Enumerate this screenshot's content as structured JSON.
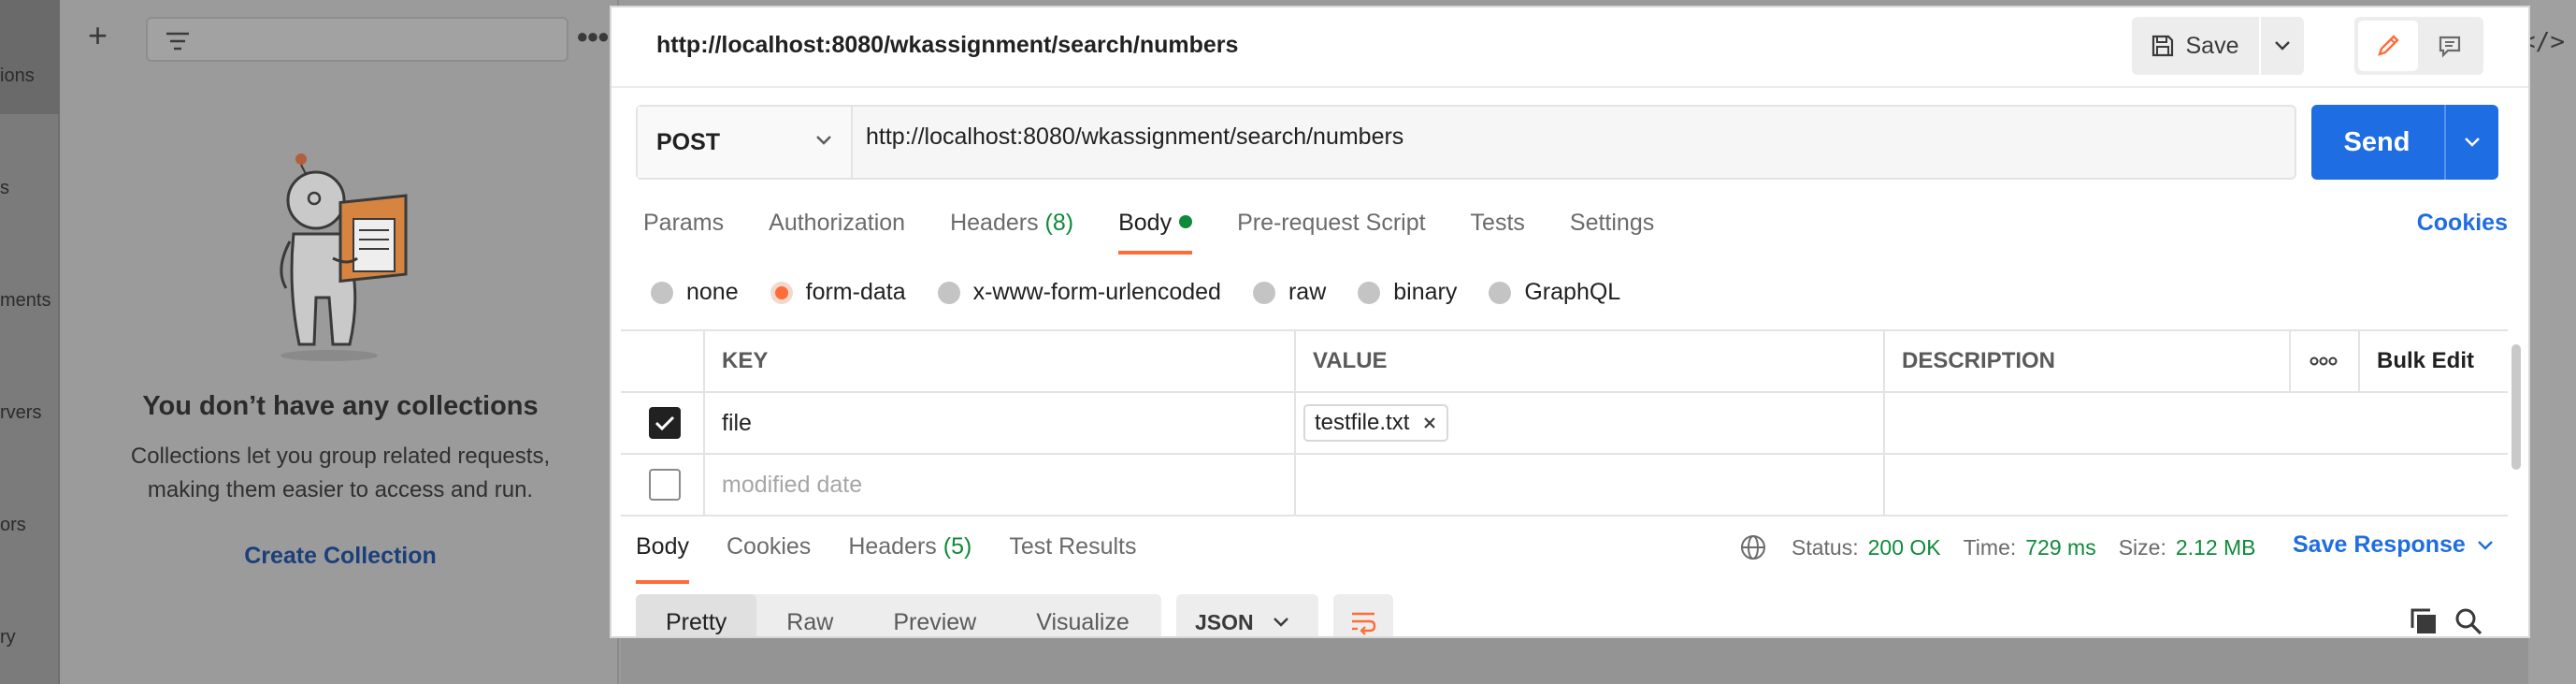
{
  "nav": {
    "items": [
      "ions",
      "s",
      "ments",
      "rvers",
      "ors",
      "ry"
    ]
  },
  "sidebar": {
    "empty_title": "You don’t have any collections",
    "empty_desc": "Collections let you group related requests, making them easier to access and run.",
    "create_label": "Create Collection"
  },
  "request": {
    "title": "http://localhost:8080/wkassignment/search/numbers",
    "save_label": "Save",
    "method": "POST",
    "url": "http://localhost:8080/wkassignment/search/numbers",
    "send_label": "Send",
    "tabs": [
      {
        "label": "Params"
      },
      {
        "label": "Authorization"
      },
      {
        "label": "Headers",
        "count": "(8)"
      },
      {
        "label": "Body"
      },
      {
        "label": "Pre-request Script"
      },
      {
        "label": "Tests"
      },
      {
        "label": "Settings"
      }
    ],
    "cookies_label": "Cookies",
    "body_modes": [
      "none",
      "form-data",
      "x-www-form-urlencoded",
      "raw",
      "binary",
      "GraphQL"
    ],
    "selected_body_mode": "form-data",
    "table": {
      "headers": {
        "key": "KEY",
        "value": "VALUE",
        "description": "DESCRIPTION",
        "bulk_edit": "Bulk Edit"
      },
      "rows": [
        {
          "key": "file",
          "value": "testfile.txt",
          "checked": true
        },
        {
          "key": "modified date",
          "value": "",
          "checked": false
        }
      ]
    }
  },
  "response": {
    "tabs": [
      {
        "label": "Body"
      },
      {
        "label": "Cookies"
      },
      {
        "label": "Headers",
        "count": "(5)"
      },
      {
        "label": "Test Results"
      }
    ],
    "status_label": "Status:",
    "status_value": "200 OK",
    "time_label": "Time:",
    "time_value": "729 ms",
    "size_label": "Size:",
    "size_value": "2.12 MB",
    "save_response_label": "Save Response",
    "formats": [
      "Pretty",
      "Raw",
      "Preview",
      "Visualize"
    ],
    "format_type": "JSON"
  },
  "colors": {
    "accent": "#ff6c37",
    "primary": "#1f6de2",
    "success": "#0f8a3a"
  }
}
